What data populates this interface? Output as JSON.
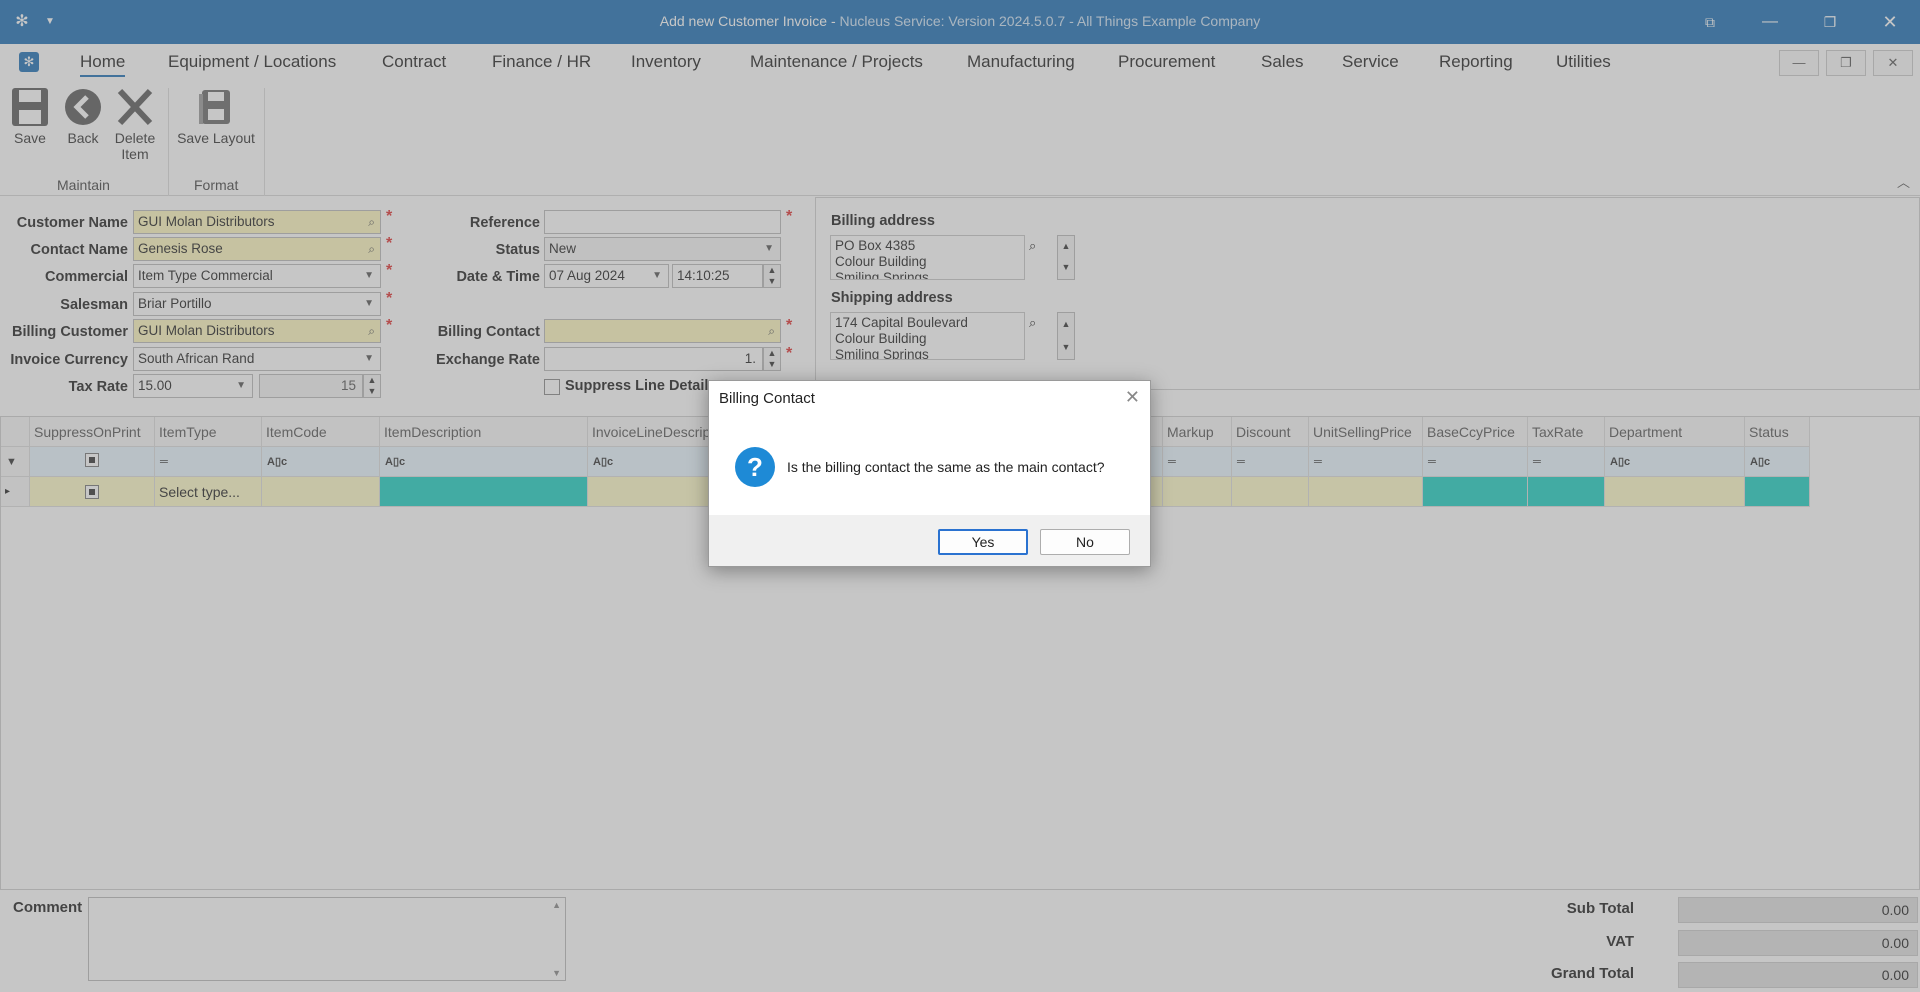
{
  "window": {
    "title_main": "Add new Customer Invoice - ",
    "title_app": "Nucleus Service: Version 2024.5.0.7 - All Things Example Company"
  },
  "menu": {
    "items": [
      "Home",
      "Equipment / Locations",
      "Contract",
      "Finance / HR",
      "Inventory",
      "Maintenance / Projects",
      "Manufacturing",
      "Procurement",
      "Sales",
      "Service",
      "Reporting",
      "Utilities"
    ],
    "active": "Home"
  },
  "ribbon": {
    "save": "Save",
    "back": "Back",
    "delete_line1": "Delete",
    "delete_line2": "Item",
    "save_layout": "Save Layout",
    "group_maintain": "Maintain",
    "group_format": "Format"
  },
  "form": {
    "customer_name_label": "Customer Name",
    "customer_name": "GUI Molan Distributors",
    "contact_name_label": "Contact Name",
    "contact_name": "Genesis Rose",
    "commercial_label": "Commercial",
    "commercial": "Item Type Commercial",
    "salesman_label": "Salesman",
    "salesman": "Briar Portillo",
    "billing_customer_label": "Billing Customer",
    "billing_customer": "GUI Molan Distributors",
    "invoice_currency_label": "Invoice Currency",
    "invoice_currency": "South African Rand",
    "tax_rate_label": "Tax Rate",
    "tax_rate": "15.00",
    "tax_rate_value": "15",
    "reference_label": "Reference",
    "reference": "",
    "status_label": "Status",
    "status": "New",
    "date_time_label": "Date & Time",
    "date": "07 Aug 2024",
    "time": "14:10:25",
    "billing_contact_label": "Billing Contact",
    "billing_contact": "",
    "exchange_rate_label": "Exchange Rate",
    "exchange_rate": "1.",
    "suppress_line_detail": "Suppress Line Detail"
  },
  "addresses": {
    "billing_label": "Billing address",
    "billing_lines": [
      "PO Box 4385",
      "Colour Building",
      "Smiling Springs"
    ],
    "shipping_label": "Shipping address",
    "shipping_lines": [
      "174 Capital Boulevard",
      "Colour Building",
      "Smiling Springs"
    ]
  },
  "grid": {
    "columns": [
      "SuppressOnPrint",
      "ItemType",
      "ItemCode",
      "ItemDescription",
      "InvoiceLineDescript",
      "Markup",
      "Discount",
      "UnitSellingPrice",
      "BaseCcyPrice",
      "TaxRate",
      "Department",
      "Status"
    ],
    "new_row_itemtype": "Select type..."
  },
  "footer": {
    "comment_label": "Comment",
    "sub_total_label": "Sub Total",
    "sub_total": "0.00",
    "vat_label": "VAT",
    "vat": "0.00",
    "grand_total_label": "Grand Total",
    "grand_total": "0.00"
  },
  "dialog": {
    "title": "Billing Contact",
    "message": "Is the billing contact the same as the main contact?",
    "yes": "Yes",
    "no": "No"
  },
  "colors": {
    "accent": "#1d6fb5",
    "required_field": "#fff9bf",
    "teal_cell": "#1dd1c3",
    "filter_row": "#e9f6ff"
  }
}
